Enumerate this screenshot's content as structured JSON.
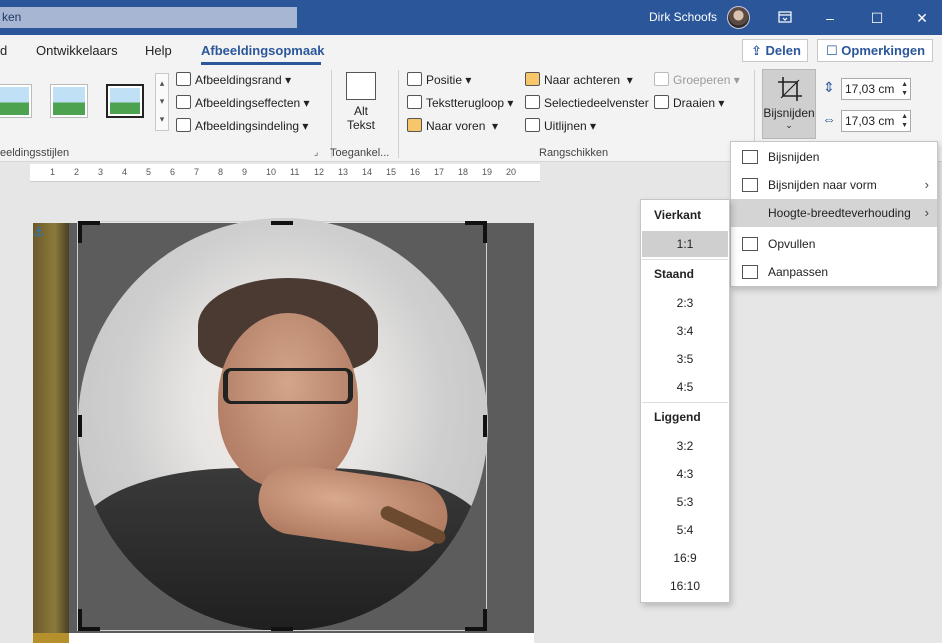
{
  "titlebar": {
    "search_text": "ken",
    "user_name": "Dirk Schoofs",
    "restore_icon": "ribbon-display-icon",
    "minimize_label": "–",
    "maximize_label": "☐",
    "close_label": "✕"
  },
  "tabs": {
    "items": [
      "d",
      "Ontwikkelaars",
      "Help",
      "Afbeeldingsopmaak"
    ],
    "active": "Afbeeldingsopmaak"
  },
  "share": {
    "label": "Delen"
  },
  "comments": {
    "label": "Opmerkingen"
  },
  "ribbon": {
    "styles_group_label": "eeldingsstijlen",
    "picture_border": "Afbeeldingsrand",
    "picture_effects": "Afbeeldingseffecten",
    "picture_layout": "Afbeeldingsindeling",
    "alt_text_line1": "Alt",
    "alt_text_line2": "Tekst",
    "accessibility_group_label": "Toegankel...",
    "position": "Positie",
    "wrap_text": "Tekstterugloop",
    "bring_forward": "Naar voren",
    "send_backward": "Naar achteren",
    "selection_pane": "Selectiedeelvenster",
    "align": "Uitlijnen",
    "group": "Groeperen",
    "rotate": "Draaien",
    "arrange_group_label": "Rangschikken",
    "crop_label": "Bijsnijden",
    "height_value": "17,03 cm",
    "width_value": "17,03 cm"
  },
  "ruler": {
    "labels": [
      "1",
      "2",
      "3",
      "4",
      "5",
      "6",
      "7",
      "8",
      "9",
      "10",
      "11",
      "12",
      "13",
      "14",
      "15",
      "16",
      "17",
      "18",
      "19",
      "20"
    ]
  },
  "crop_menu": {
    "items": [
      {
        "label": "Bijsnijden",
        "has_arrow": false,
        "icon": "crop-icon"
      },
      {
        "label": "Bijsnijden naar vorm",
        "has_arrow": true,
        "icon": "crop-to-shape-icon"
      },
      {
        "label": "Hoogte-breedteverhouding",
        "has_arrow": true,
        "icon": "",
        "hover": true
      },
      {
        "label": "Opvullen",
        "has_arrow": false,
        "icon": "fill-icon"
      },
      {
        "label": "Aanpassen",
        "has_arrow": false,
        "icon": "fit-icon"
      }
    ],
    "arrow": "›"
  },
  "aspect_submenu": {
    "sections": [
      {
        "heading": "Vierkant",
        "items": [
          "1:1"
        ]
      },
      {
        "heading": "Staand",
        "items": [
          "2:3",
          "3:4",
          "3:5",
          "4:5"
        ]
      },
      {
        "heading": "Liggend",
        "items": [
          "3:2",
          "4:3",
          "5:3",
          "5:4",
          "16:9",
          "16:10"
        ]
      }
    ],
    "selected": "1:1"
  }
}
